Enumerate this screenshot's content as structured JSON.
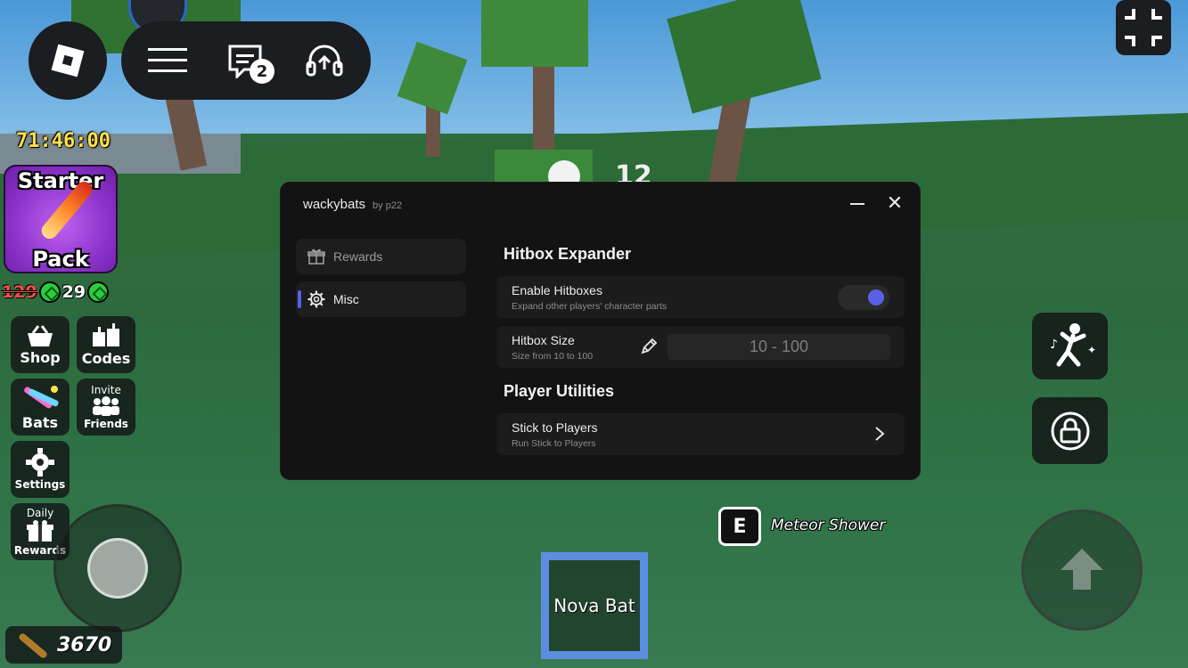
{
  "hud": {
    "timer": "71:46:00",
    "starter_pack": {
      "line1": "Starter",
      "line2": "Pack"
    },
    "price_old": "129",
    "price_new": "29",
    "chat_badge": "2",
    "buttons": {
      "shop": "Shop",
      "codes": "Codes",
      "bats": "Bats",
      "invite_top": "Invite",
      "invite_bottom": "Friends",
      "settings": "Settings",
      "daily_top": "Daily",
      "daily_bottom": "Rewards"
    },
    "coins": "3670",
    "center_number": "12"
  },
  "prompt": {
    "key": "E",
    "action": "Meteor Shower"
  },
  "hotbar": {
    "slot1": "Nova Bat"
  },
  "panel": {
    "title": "wackybats",
    "subtitle": "by p22",
    "nav": [
      {
        "label": "Rewards",
        "icon": "gift-icon",
        "active": false
      },
      {
        "label": "Misc",
        "icon": "gear-icon",
        "active": true
      }
    ],
    "sections": [
      {
        "title": "Hitbox Expander",
        "rows": [
          {
            "title": "Enable Hitboxes",
            "desc": "Expand other players' character parts",
            "type": "toggle",
            "enabled": true
          },
          {
            "title": "Hitbox Size",
            "desc": "Size from 10 to 100",
            "type": "slider-input",
            "value": "10 - 100"
          }
        ]
      },
      {
        "title": "Player Utilities",
        "rows": [
          {
            "title": "Stick to Players",
            "desc": "Run Stick to Players",
            "type": "button"
          }
        ]
      }
    ]
  },
  "colors": {
    "accent": "#5b5fe8",
    "hotbar_border": "#5b8ee0",
    "timer": "#ffe14a",
    "panel_bg": "#131313"
  }
}
